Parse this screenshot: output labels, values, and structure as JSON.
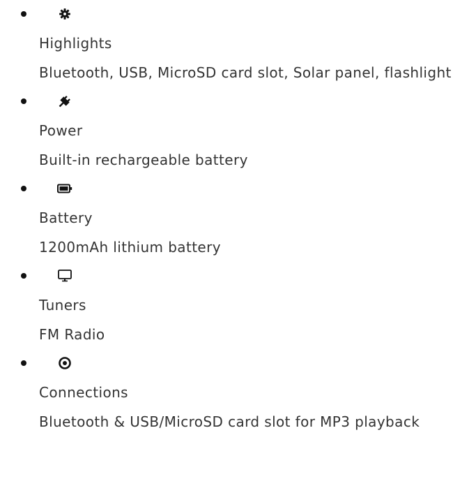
{
  "features": [
    {
      "icon": "gear-icon",
      "title": "Highlights",
      "value": "Bluetooth, USB, MicroSD card slot, Solar panel, flashlight"
    },
    {
      "icon": "plug-icon",
      "title": "Power",
      "value": "Built-in rechargeable battery"
    },
    {
      "icon": "battery-icon",
      "title": "Battery",
      "value": "1200mAh lithium battery"
    },
    {
      "icon": "monitor-icon",
      "title": "Tuners",
      "value": "FM Radio"
    },
    {
      "icon": "target-icon",
      "title": "Connections",
      "value": "Bluetooth & USB/MicroSD card slot for MP3 playback"
    }
  ],
  "colors": {
    "text": "#333333",
    "bullet": "#111111",
    "icon": "#111111"
  }
}
